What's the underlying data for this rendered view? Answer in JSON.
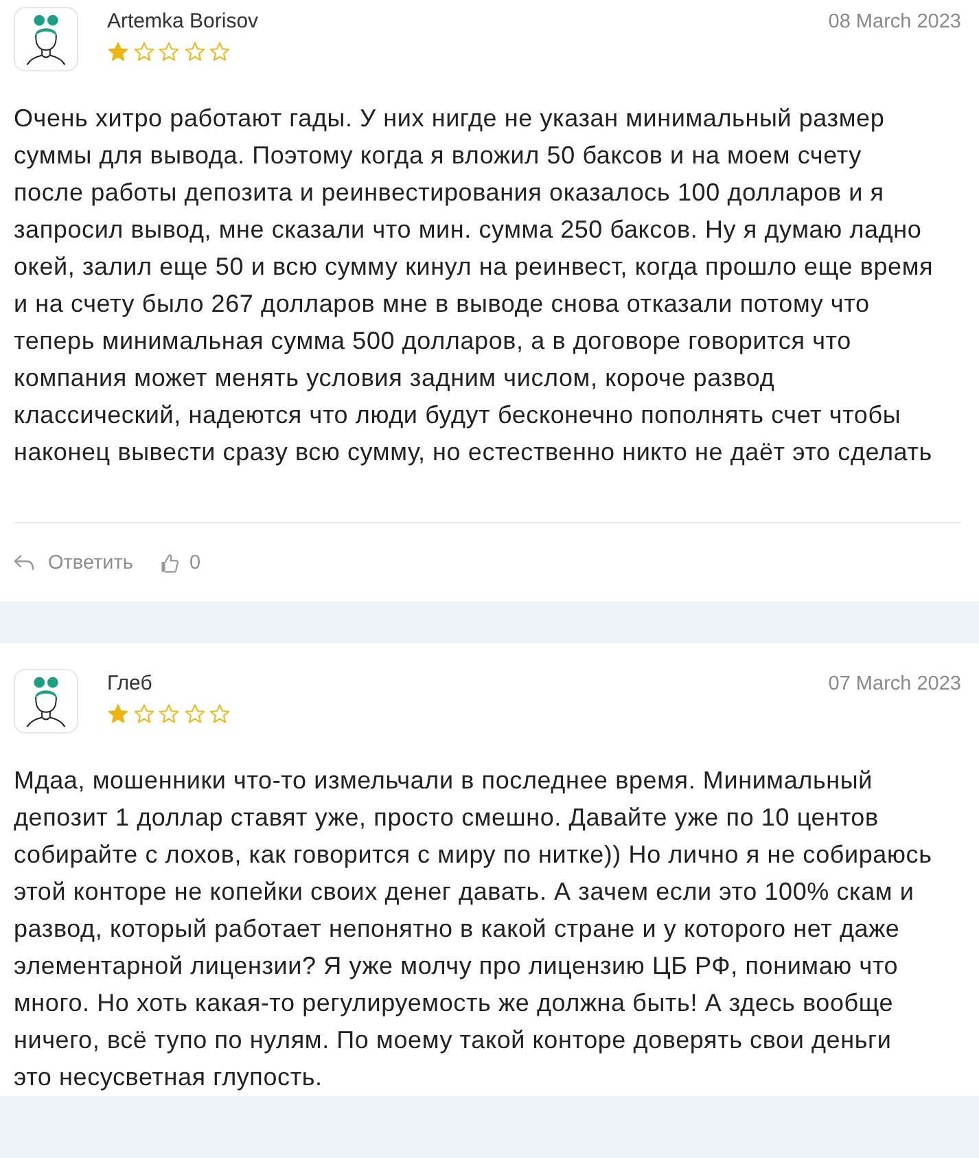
{
  "reviews": [
    {
      "author": "Artemka Borisov",
      "date": "08 March 2023",
      "stars": 1,
      "text": "Очень хитро работают гады. У них нигде не указан минимальный размер суммы для вывода. Поэтому когда я вложил 50 баксов и на моем счету после работы депозита и реинвестирования оказалось 100 долларов и я запросил вывод, мне сказали что мин. сумма 250 баксов. Ну я думаю ладно окей, залил еще 50 и всю сумму кинул на реинвест, когда прошло еще время и на счету было 267 долларов мне в выводе снова отказали потому что теперь минимальная сумма 500 долларов, а в договоре говорится что компания может менять условия задним числом, короче развод классический, надеются что люди будут бесконечно пополнять счет чтобы наконец вывести сразу всю сумму, но естественно никто не даёт это сделать",
      "reply_label": "Ответить",
      "likes": "0"
    },
    {
      "author": "Глеб",
      "date": "07 March 2023",
      "stars": 1,
      "text": "Мдаа, мошенники что-то измельчали в последнее время. Минимальный депозит 1 доллар ставят уже, просто смешно. Давайте уже по 10 центов собирайте с лохов, как говорится с миру по нитке)) Но лично я не собираюсь этой конторе не копейки своих денег давать. А зачем если это 100% скам и развод, который работает непонятно в какой стране и у которого нет даже элементарной лицензии? Я уже молчу про лицензию ЦБ РФ, понимаю что много. Но хоть какая-то регулируемость же должна быть! А здесь вообще ничего, всё тупо по нулям. По моему такой конторе доверять свои деньги это несусветная глупость."
    }
  ]
}
